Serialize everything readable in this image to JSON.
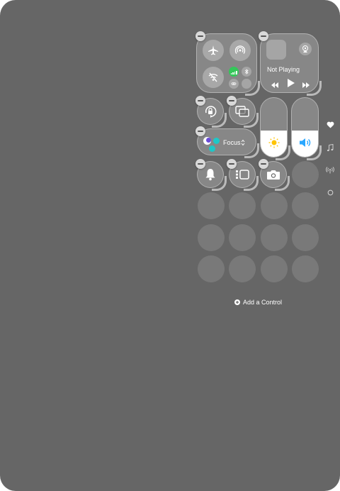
{
  "media": {
    "status": "Not Playing"
  },
  "focus": {
    "label": "Focus"
  },
  "add_control": {
    "label": "Add a Control"
  },
  "page_indicators": [
    {
      "name": "favorites",
      "icon": "heart-icon",
      "active": true
    },
    {
      "name": "music",
      "icon": "music-note-icon",
      "active": false
    },
    {
      "name": "connectivity",
      "icon": "antenna-icon",
      "active": false
    },
    {
      "name": "empty-page",
      "icon": "circle-icon",
      "active": false
    }
  ],
  "sliders": {
    "brightness_level": 0.45,
    "volume_level": 0.45
  },
  "colors": {
    "background": "#666666",
    "cellular_green": "#34c759",
    "volume_blue": "#2aa7ff",
    "sun_yellow": "#ffc400"
  }
}
